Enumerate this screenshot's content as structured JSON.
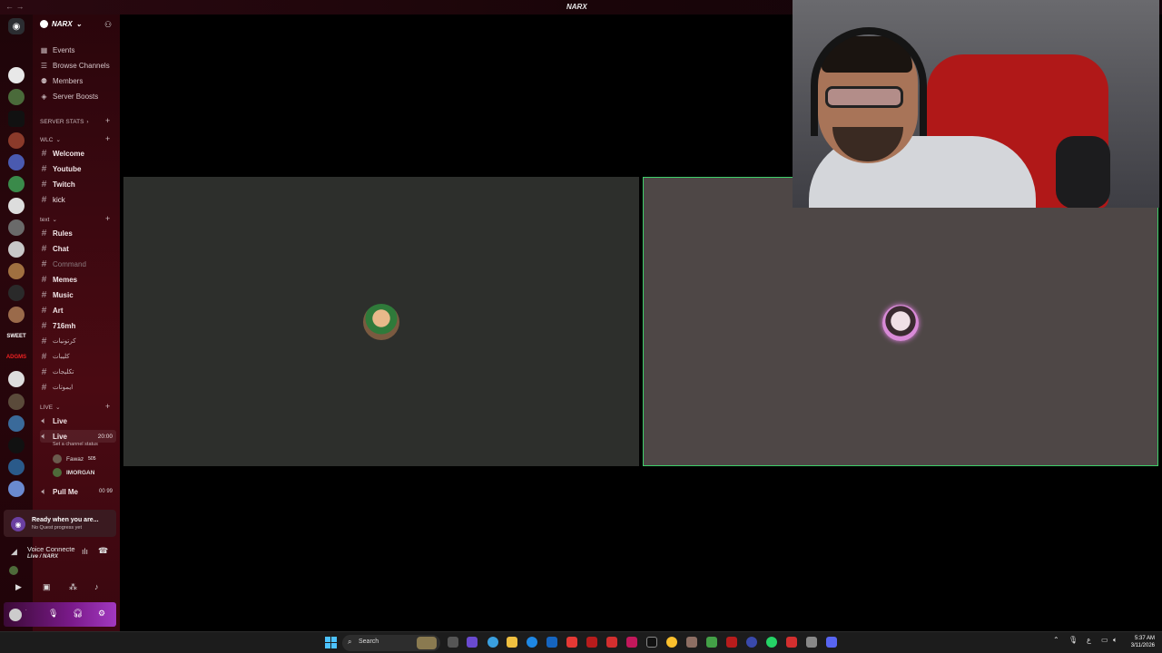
{
  "window": {
    "title": "NARX"
  },
  "server": {
    "name": "NARX"
  },
  "menu": [
    {
      "label": "Events",
      "icon": "calendar-icon"
    },
    {
      "label": "Browse Channels",
      "icon": "list-icon"
    },
    {
      "label": "Members",
      "icon": "members-icon"
    },
    {
      "label": "Server Boosts",
      "icon": "boost-icon"
    }
  ],
  "categories": {
    "server_stats": "SERVER STATS",
    "wlc": "WLC",
    "text": "text",
    "live": "LIVE"
  },
  "wlc_channels": [
    "Welcome",
    "Youtube",
    "Twitch",
    "kick"
  ],
  "text_channels": [
    "Rules",
    "Chat",
    "Command",
    "Memes",
    "Music",
    "Art",
    "716mh",
    "كرتونيات",
    "كليبات",
    "تكليجات",
    "ايموتات"
  ],
  "voice_channels": {
    "live1": "Live",
    "live2": "Live",
    "live2_timer": "20:00",
    "live2_status": "Set a channel status",
    "pull_me": "Pull Me",
    "pull_me_count": "00  99"
  },
  "voice_users": [
    {
      "name": "Fawaz",
      "badge": "505"
    },
    {
      "name": "IMORGAN",
      "badge": ""
    }
  ],
  "rail_labels": [
    "SWEET",
    "ADGMS"
  ],
  "quest": {
    "title": "Ready when you are...",
    "subtitle": "No Quest progress yet"
  },
  "voice_panel": {
    "title": "Voice Connecte",
    "subtitle": "Live / NARX"
  },
  "taskbar": {
    "search_placeholder": "Search",
    "time": "5:37 AM",
    "date": "3/11/2026",
    "lang": "ع"
  },
  "colors": {
    "sidebar": "#3a0810",
    "tile_left": "#2d2f2c",
    "tile_right": "#4e4746",
    "speaking_border": "#3ecf6a",
    "userbar_accent": "#a238c0"
  }
}
